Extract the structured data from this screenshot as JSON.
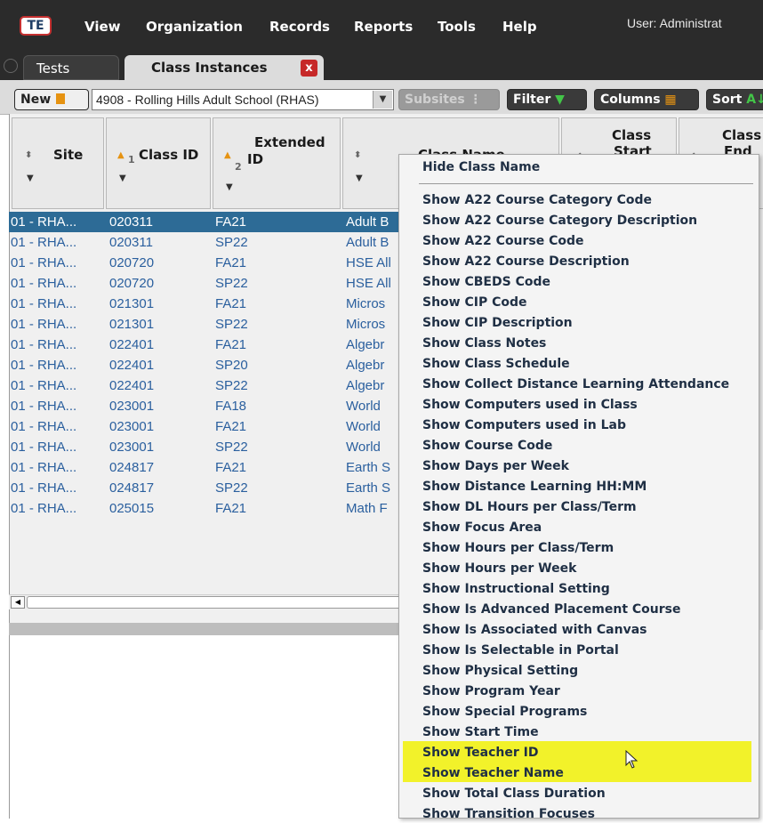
{
  "menubar": {
    "logo": "TE",
    "items": [
      "View",
      "Organization",
      "Records",
      "Reports",
      "Tools",
      "Help"
    ],
    "user_label": "User: Administrat"
  },
  "tabs": {
    "tests": "Tests",
    "class_instances": "Class Instances",
    "close_glyph": "x"
  },
  "toolbar": {
    "new_label": "New",
    "site_value": "4908 - Rolling Hills Adult School (RHAS)",
    "subsites_label": "Subsites",
    "filter_label": "Filter",
    "columns_label": "Columns",
    "sort_label": "Sort",
    "sort_glyph": "A↓"
  },
  "grid": {
    "columns": {
      "site": "Site",
      "class_id": "Class ID",
      "class_id_rank": "1",
      "extended_id_1": "Extended",
      "extended_id_2": "ID",
      "extended_rank": "2",
      "class_name": "Class Name",
      "class_start_1": "Class",
      "class_start_2": "Start",
      "class_end_1": "Class",
      "class_end_2": "End"
    },
    "rows": [
      {
        "site": "01 - RHA...",
        "class_id": "020311",
        "ext": "FA21",
        "name": "Adult B"
      },
      {
        "site": "01 - RHA...",
        "class_id": "020311",
        "ext": "SP22",
        "name": "Adult B"
      },
      {
        "site": "01 - RHA...",
        "class_id": "020720",
        "ext": "FA21",
        "name": "HSE All"
      },
      {
        "site": "01 - RHA...",
        "class_id": "020720",
        "ext": "SP22",
        "name": "HSE All"
      },
      {
        "site": "01 - RHA...",
        "class_id": "021301",
        "ext": "FA21",
        "name": "Micros"
      },
      {
        "site": "01 - RHA...",
        "class_id": "021301",
        "ext": "SP22",
        "name": "Micros"
      },
      {
        "site": "01 - RHA...",
        "class_id": "022401",
        "ext": "FA21",
        "name": "Algebr"
      },
      {
        "site": "01 - RHA...",
        "class_id": "022401",
        "ext": "SP20",
        "name": "Algebr"
      },
      {
        "site": "01 - RHA...",
        "class_id": "022401",
        "ext": "SP22",
        "name": "Algebr"
      },
      {
        "site": "01 - RHA...",
        "class_id": "023001",
        "ext": "FA18",
        "name": "World"
      },
      {
        "site": "01 - RHA...",
        "class_id": "023001",
        "ext": "FA21",
        "name": "World"
      },
      {
        "site": "01 - RHA...",
        "class_id": "023001",
        "ext": "SP22",
        "name": "World"
      },
      {
        "site": "01 - RHA...",
        "class_id": "024817",
        "ext": "FA21",
        "name": "Earth S"
      },
      {
        "site": "01 - RHA...",
        "class_id": "024817",
        "ext": "SP22",
        "name": "Earth S"
      },
      {
        "site": "01 - RHA...",
        "class_id": "025015",
        "ext": "FA21",
        "name": "Math F"
      }
    ]
  },
  "context_menu": {
    "hide_item": "Hide Class Name",
    "items": [
      "Show A22 Course Category Code",
      "Show A22 Course Category Description",
      "Show A22 Course Code",
      "Show A22 Course Description",
      "Show CBEDS Code",
      "Show CIP Code",
      "Show CIP Description",
      "Show Class Notes",
      "Show Class Schedule",
      "Show Collect Distance Learning Attendance",
      "Show Computers used in Class",
      "Show Computers used in Lab",
      "Show Course Code",
      "Show Days per Week",
      "Show Distance Learning HH:MM",
      "Show DL Hours per Class/Term",
      "Show Focus Area",
      "Show Hours per Class/Term",
      "Show Hours per Week",
      "Show Instructional Setting",
      "Show Is Advanced Placement Course",
      "Show Is Associated with Canvas",
      "Show Is Selectable in Portal",
      "Show Physical Setting",
      "Show Program Year",
      "Show Special Programs",
      "Show Start Time",
      "Show Teacher ID",
      "Show Teacher Name",
      "Show Total Class Duration",
      "Show Transition Focuses"
    ],
    "highlight_color": "#f2f22a"
  },
  "colors": {
    "menubar_bg": "#2b2b2b",
    "selected_row": "#2d6b96",
    "row_text": "#2a5f9e",
    "filter_icon": "#43c548",
    "new_icon": "#e69312"
  }
}
